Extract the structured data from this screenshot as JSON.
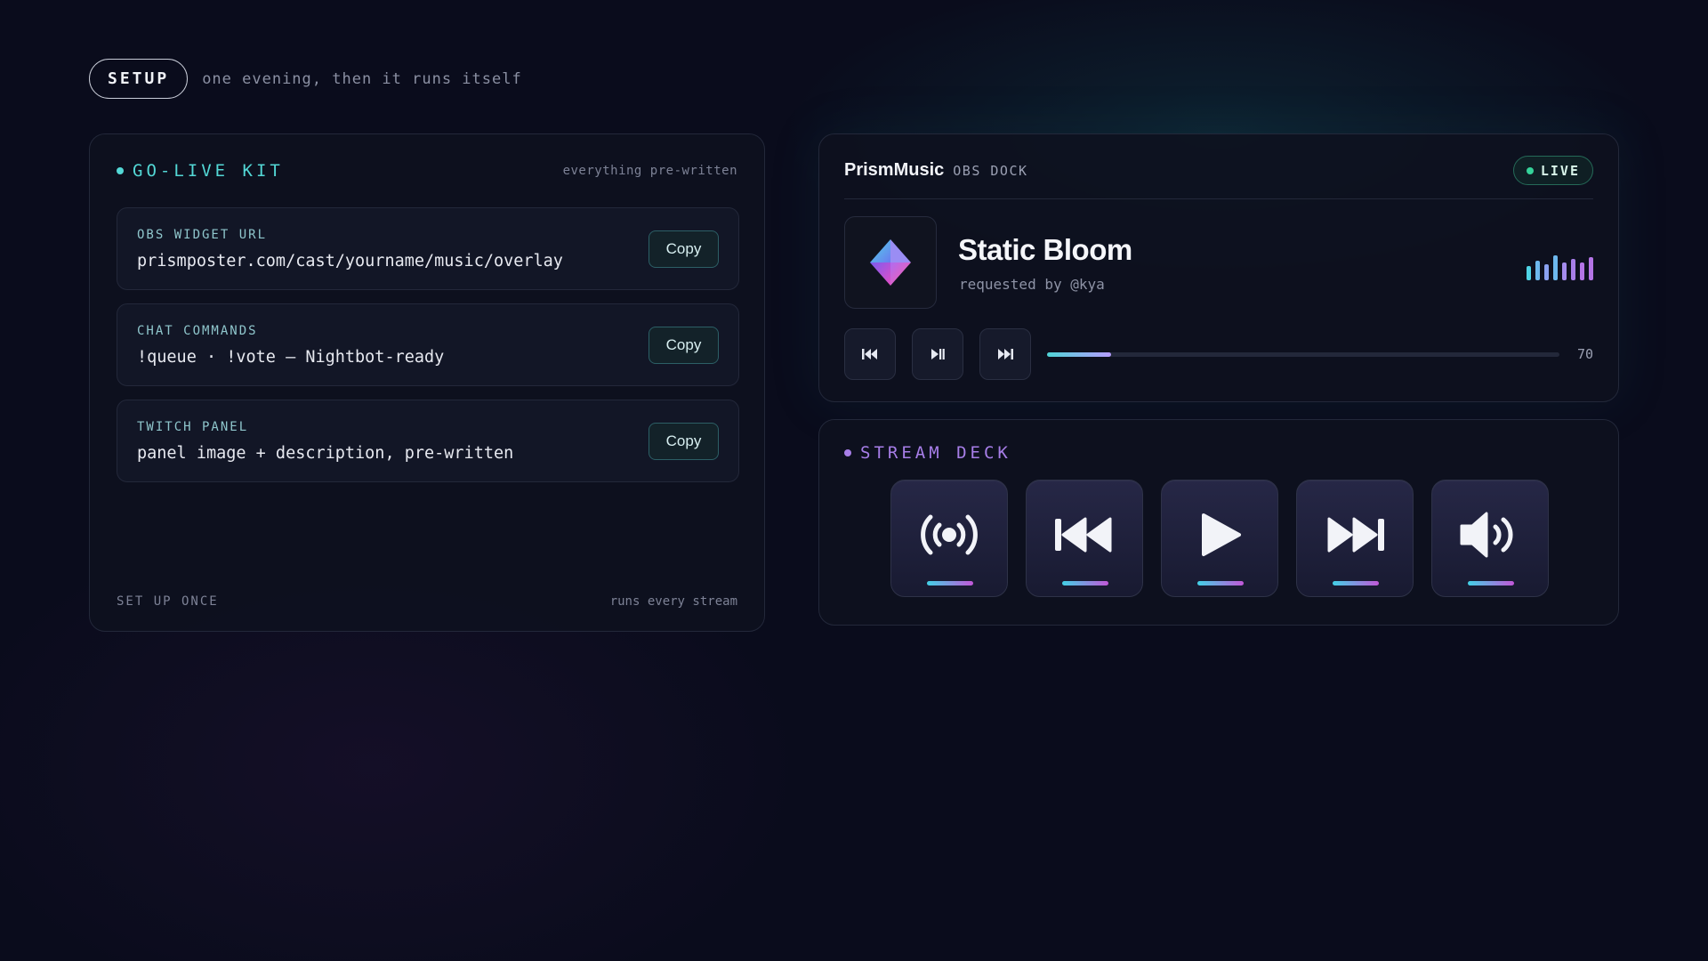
{
  "header": {
    "pill": "SETUP",
    "tagline": "one evening, then it runs itself"
  },
  "kit": {
    "title": "GO-LIVE KIT",
    "note": "everything pre-written",
    "items": [
      {
        "label": "OBS WIDGET URL",
        "value": "prismposter.com/cast/yourname/music/overlay",
        "button": "Copy"
      },
      {
        "label": "CHAT COMMANDS",
        "value": "!queue · !vote — Nightbot-ready",
        "button": "Copy"
      },
      {
        "label": "TWITCH PANEL",
        "value": "panel image + description, pre-written",
        "button": "Copy"
      }
    ],
    "footer_left": "SET UP ONCE",
    "footer_right": "runs every stream"
  },
  "dock": {
    "brand": "PrismMusic",
    "sub": "OBS DOCK",
    "status": "LIVE",
    "track": {
      "title": "Static Bloom",
      "requested": "requested by @kya"
    },
    "controls": [
      "previous-icon",
      "play-pause-icon",
      "next-icon"
    ],
    "progress_value": "70",
    "progress_fraction": 0.125
  },
  "deck": {
    "title": "STREAM DECK",
    "buttons": [
      "broadcast-icon",
      "previous-icon",
      "play-icon",
      "next-icon",
      "volume-icon"
    ]
  },
  "colors": {
    "teal": "#53d8d6",
    "purple": "#a77ee8",
    "live": "#35d39a",
    "background": "#0a0c1c"
  }
}
